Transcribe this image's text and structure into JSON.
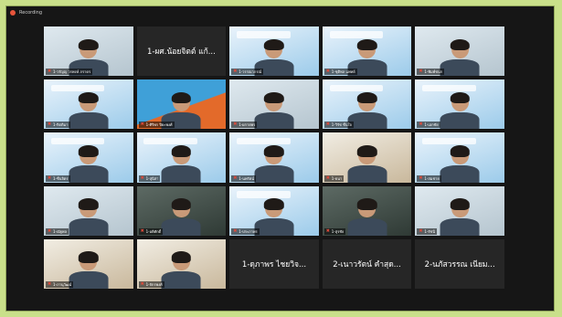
{
  "window": {
    "title": "Recording"
  },
  "tiles": [
    {
      "id": "t0",
      "kind": "video",
      "label": "1-วรัญญ วรพงษ์ ภราดร"
    },
    {
      "id": "t1",
      "kind": "empty",
      "center": "1-ผศ.น้อยจิตต์ แก้..."
    },
    {
      "id": "t2",
      "kind": "slide",
      "label": "1-วรรณาภรณ์"
    },
    {
      "id": "t3",
      "kind": "slide",
      "label": "1-ชุติพล แพทย์"
    },
    {
      "id": "t4",
      "kind": "video",
      "label": "1-พิมพ์ชนก"
    },
    {
      "id": "t5",
      "kind": "slide",
      "label": "1-กิตติมา"
    },
    {
      "id": "t6",
      "kind": "orange",
      "label": "1-ศิริพร ปิยะพงศ์"
    },
    {
      "id": "t7",
      "kind": "video",
      "label": "1-ผกายพร"
    },
    {
      "id": "t8",
      "kind": "slide",
      "label": "1-วิรัช ชื่นใจ"
    },
    {
      "id": "t9",
      "kind": "slide",
      "label": "1-เอกชัย"
    },
    {
      "id": "t10",
      "kind": "slide",
      "label": "1-ชื่นจิตร"
    },
    {
      "id": "t11",
      "kind": "slide",
      "label": "1-สุนิสา"
    },
    {
      "id": "t12",
      "kind": "slide",
      "label": "1-นพรัตน์"
    },
    {
      "id": "t13",
      "kind": "room",
      "label": "1-ธนา"
    },
    {
      "id": "t14",
      "kind": "slide",
      "label": "1-สมชาย"
    },
    {
      "id": "t15",
      "kind": "video",
      "label": "1-ณัฐพล"
    },
    {
      "id": "t16",
      "kind": "dark",
      "label": "1-อดิศักดิ์"
    },
    {
      "id": "t17",
      "kind": "slide",
      "label": "1-ประภาพร"
    },
    {
      "id": "t18",
      "kind": "dark",
      "label": "1-สุรชัย"
    },
    {
      "id": "t19",
      "kind": "video",
      "label": "1-รัชนี"
    },
    {
      "id": "t20",
      "kind": "room",
      "label": "1-ภานุวัฒน์"
    },
    {
      "id": "t21",
      "kind": "room",
      "label": "1-จักรพงศ์"
    },
    {
      "id": "t22",
      "kind": "empty",
      "center": "1-ดุภาพร ไชยวิจ..."
    },
    {
      "id": "t23",
      "kind": "empty",
      "center": "2-เนาวรัตน์ คำสุด..."
    },
    {
      "id": "t24",
      "kind": "empty",
      "center": "2-นภัสวรรณ เนียม..."
    }
  ]
}
